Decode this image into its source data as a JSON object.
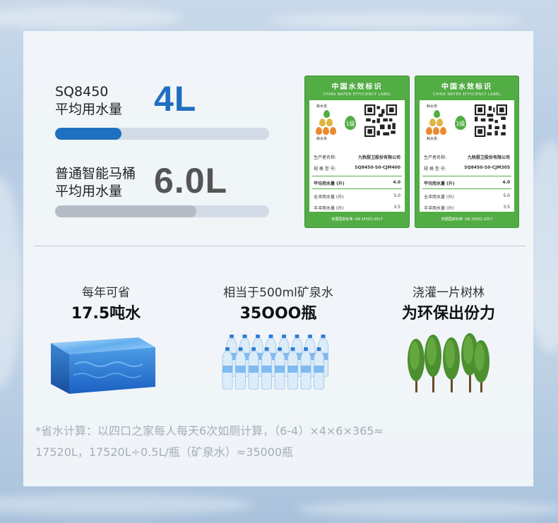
{
  "model_block": {
    "model_label": "SQ8450",
    "avg_label": "平均用水量",
    "value": "4L",
    "value_color": "#1f6fc0",
    "bar_fraction": 0.31
  },
  "common_block": {
    "name_label": "普通智能马桶",
    "avg_label": "平均用水量",
    "value": "6.0L",
    "value_color": "#555555",
    "bar_fraction": 0.66
  },
  "labels": [
    {
      "title": "中国水效标识",
      "subtitle": "CHINA WATER EFFICIENCY LABEL",
      "low_text": "耗水低",
      "high_text": "耗水高",
      "grade": "1级",
      "producer_key": "生产者名称:",
      "producer_val": "九牧厨卫股份有限公司",
      "model_key": "规 格 型 号:",
      "model_val": "SQ8450-S0-CJM400",
      "avg_key": "平均用水量 (升)",
      "avg_val": "4.0",
      "full_key": "全冲用水量 (升)",
      "full_val": "5.0",
      "half_key": "半冲用水量 (升)",
      "half_val": "3.5",
      "footer": "依据国家标准: GB 25502-2017"
    },
    {
      "title": "中国水效标识",
      "subtitle": "CHINA WATER EFFICIENCY LABEL",
      "low_text": "耗水低",
      "high_text": "耗水高",
      "grade": "1级",
      "producer_key": "生产者名称:",
      "producer_val": "九牧厨卫股份有限公司",
      "model_key": "规 格 型 号:",
      "model_val": "SQ8450-S0-CJM305",
      "avg_key": "平均用水量 (升)",
      "avg_val": "4.0",
      "full_key": "全冲用水量 (升)",
      "full_val": "5.0",
      "half_key": "半冲用水量 (升)",
      "half_val": "3.5",
      "footer": "依据国家标准: GB 25502-2017"
    }
  ],
  "stats": [
    {
      "caption": "每年可省",
      "value": "17.5吨水",
      "icon": "water-cube-icon"
    },
    {
      "caption": "相当于500ml矿泉水",
      "value": "35OOO瓶",
      "icon": "water-bottles-icon"
    },
    {
      "caption": "浇灌一片树林",
      "value": "为环保出份力",
      "icon": "forest-icon"
    }
  ],
  "footnote": {
    "line1": "*省水计算：以四口之家每人每天6次如厕计算，（6-4）×4×6×365≈",
    "line2": "17520L，17520L÷0.5L/瓶（矿泉水）≈35000瓶"
  }
}
